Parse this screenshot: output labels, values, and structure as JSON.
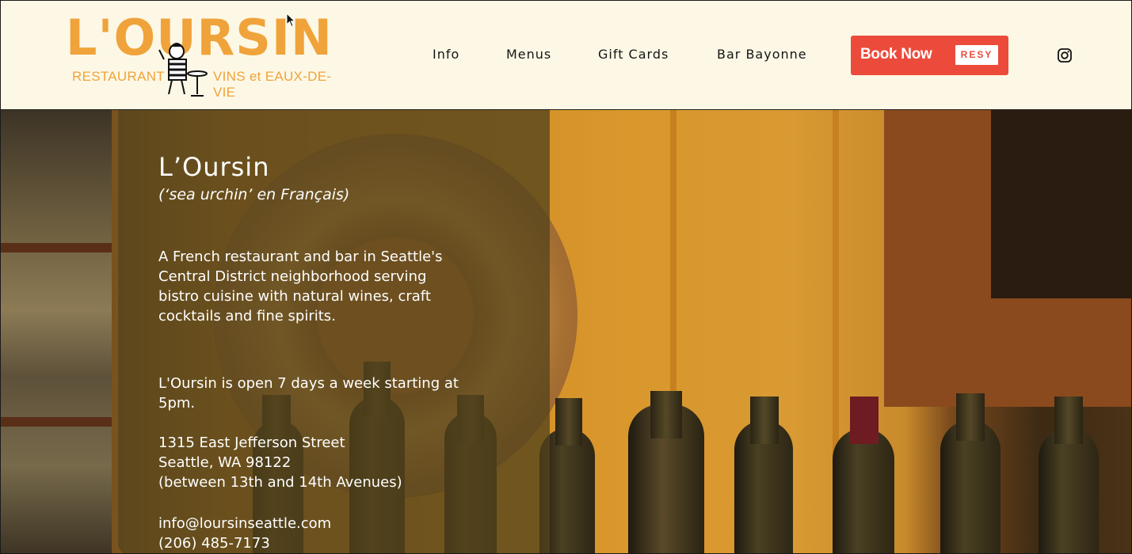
{
  "brand": {
    "logo_word": "L'OURSIN",
    "logo_left": "RESTAURANT",
    "logo_right": "VINS et EAUX-DE-VIE",
    "accent": "#f0a33a"
  },
  "nav": {
    "items": [
      "Info",
      "Menus",
      "Gift Cards",
      "Bar Bayonne"
    ]
  },
  "cta": {
    "label": "Book Now",
    "badge": "RESY",
    "color": "#ec4b3c"
  },
  "social": {
    "icon": "instagram-icon"
  },
  "hero": {
    "title": "L’Oursin",
    "subtitle": "(‘sea urchin’ en Français)",
    "description_lines": [
      "A French restaurant and bar in Seattle's",
      "Central District neighborhood serving",
      "bistro cuisine with natural wines, craft",
      "cocktails and fine spirits."
    ],
    "hours_lines": [
      "L'Oursin is open 7 days a week starting at",
      "5pm."
    ],
    "address_lines": [
      "1315 East Jefferson Street",
      "Seattle, WA 98122",
      "(between 13th and 14th Avenues)"
    ],
    "email": "info@loursinseattle.com",
    "phone": "(206) 485-7173"
  },
  "colors": {
    "header_bg": "#fdf8e6",
    "overlay": "#54441c"
  }
}
